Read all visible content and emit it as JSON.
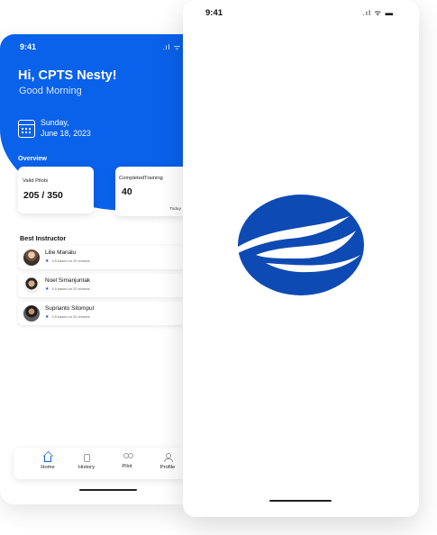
{
  "left_screen": {
    "status": {
      "time": "9:41",
      "icons": ".ıl ᯤ"
    },
    "greeting": {
      "name": "Hi, CPTS Nesty!",
      "subtitle": "Good Morning"
    },
    "date": {
      "day": "Sunday,",
      "full": "June 18, 2023"
    },
    "overview": {
      "label": "Overview",
      "valid": {
        "title": "Valid Pilots",
        "value": "205 / 350"
      },
      "completed": {
        "title": "CompletedTraining",
        "value": "40",
        "footnote": "Today"
      }
    },
    "best_instructor": {
      "title": "Best Instructor",
      "items": [
        {
          "name": "Lilie Manalu",
          "meta": "4.5 based on 20 reviews"
        },
        {
          "name": "Noel Simanjuntak",
          "meta": "4.5 based on 20 reviews"
        },
        {
          "name": "Suprianto Sitompul",
          "meta": "4.5 based on 20 reviews"
        }
      ]
    },
    "bottom_nav": [
      {
        "label": "Home",
        "icon": "home-icon"
      },
      {
        "label": "History",
        "icon": "history-icon"
      },
      {
        "label": "Pilot",
        "icon": "pilot-icon"
      },
      {
        "label": "Profile",
        "icon": "profile-icon"
      }
    ]
  },
  "right_screen": {
    "status": {
      "time": "9:41",
      "icons": ".ıl ᯤ ▬"
    },
    "logo": "blue-globe-logo"
  },
  "colors": {
    "primary_blue": "#0a61ea",
    "logo_blue": "#0e4ab3",
    "text_dark": "#111111",
    "white": "#ffffff"
  }
}
